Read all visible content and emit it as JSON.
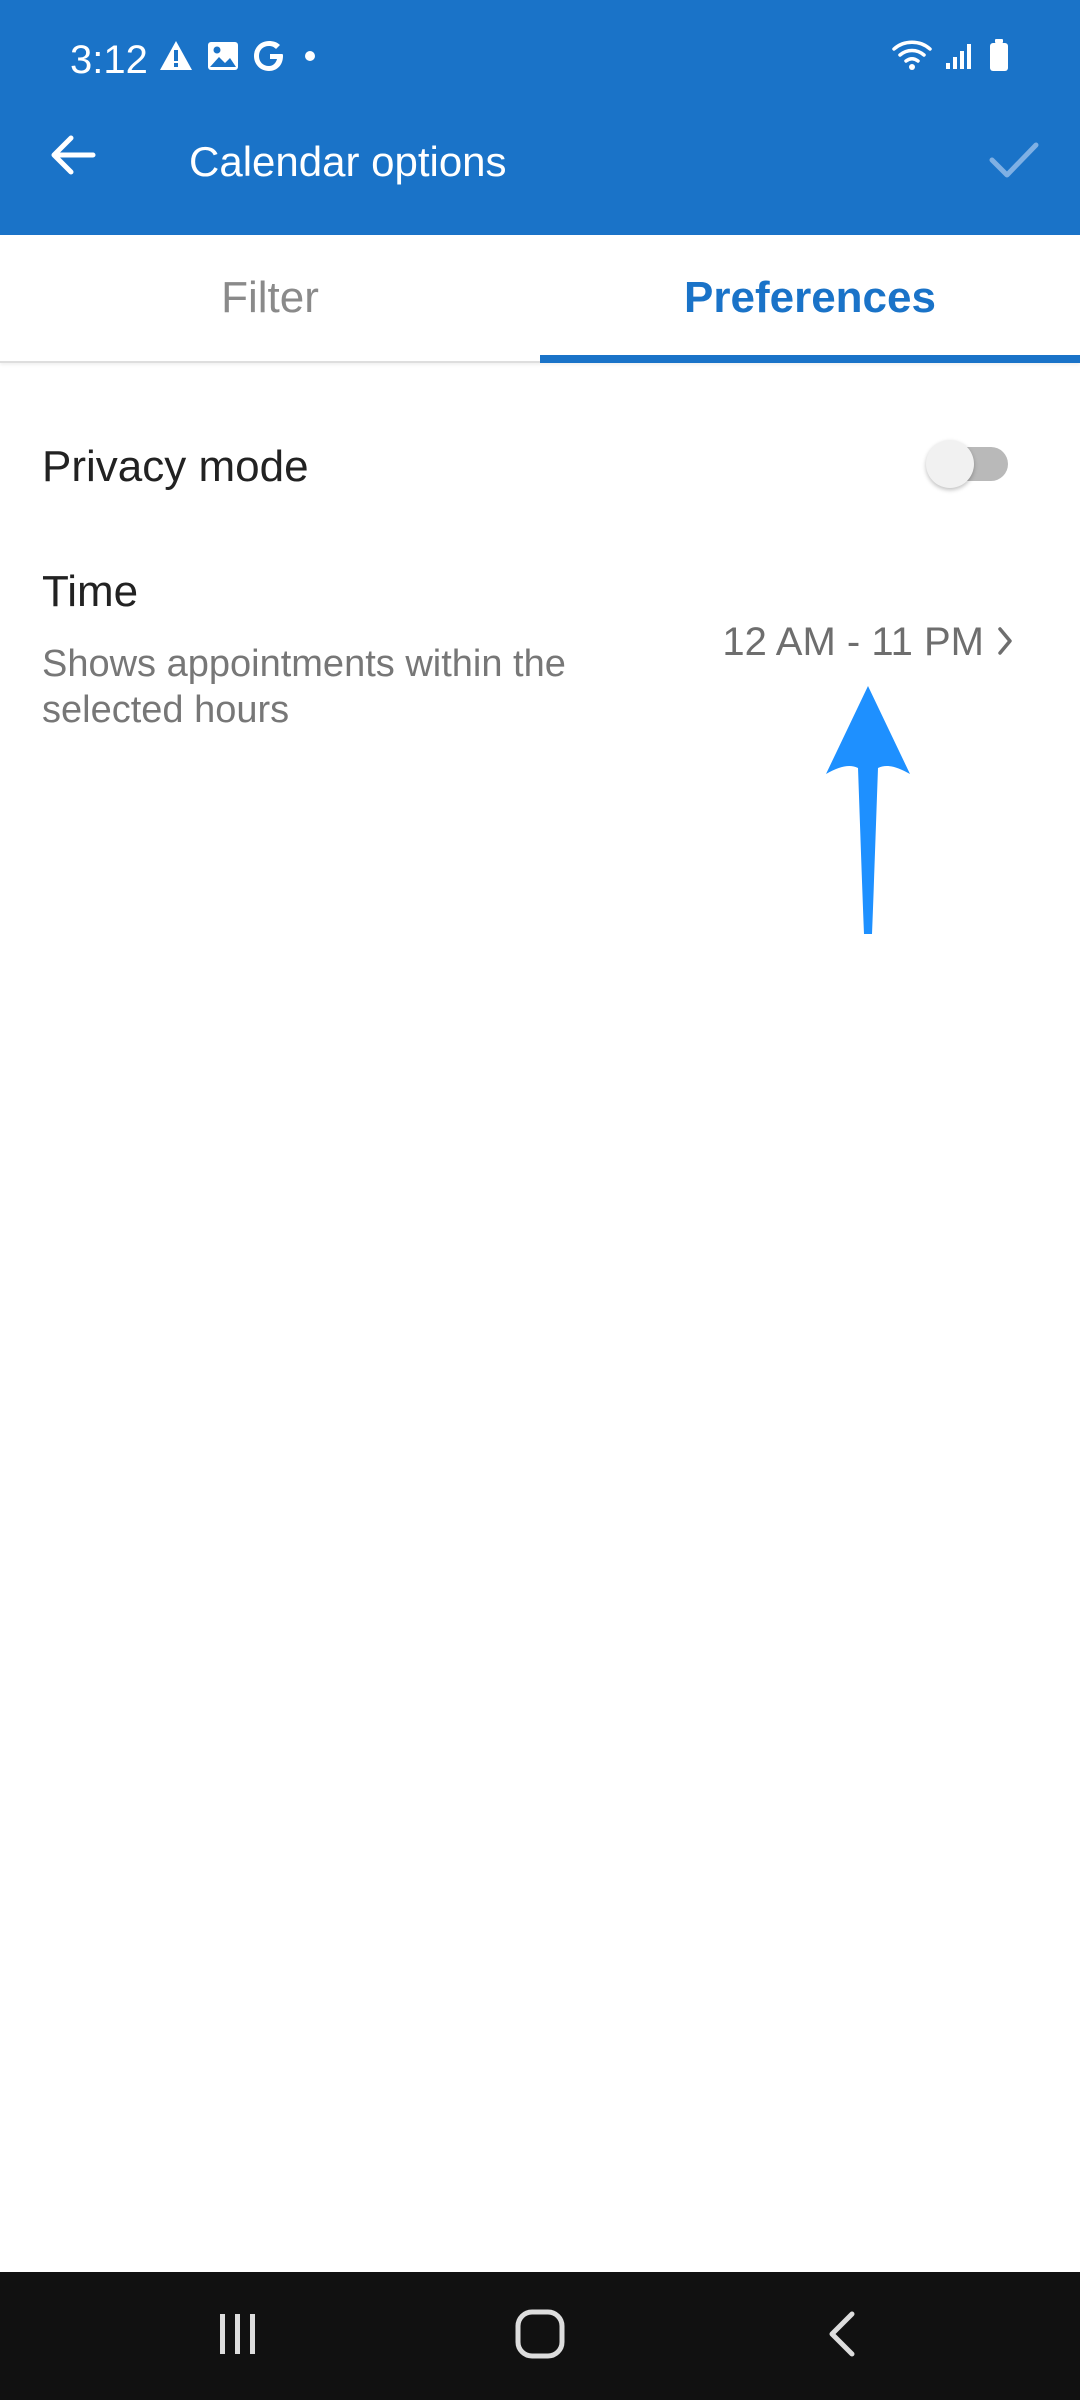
{
  "status_bar": {
    "time": "3:12",
    "left_icons": [
      "warning-icon",
      "image-icon",
      "google-icon",
      "dot-icon"
    ],
    "right_icons": [
      "wifi-icon",
      "signal-icon",
      "battery-icon"
    ]
  },
  "app_bar": {
    "title": "Calendar options",
    "back_icon": "arrow-left-icon",
    "confirm_icon": "checkmark-icon",
    "background_color": "#1a73c8"
  },
  "tabs": [
    {
      "label": "Filter",
      "selected": false
    },
    {
      "label": "Preferences",
      "selected": true
    }
  ],
  "preferences": {
    "privacy_mode": {
      "label": "Privacy mode",
      "enabled": false
    },
    "time": {
      "label": "Time",
      "description": "Shows appointments within the selected hours",
      "value": "12 AM - 11 PM",
      "chevron_icon": "chevron-right-icon"
    }
  },
  "annotation": {
    "icon": "arrow-up-icon",
    "color": "#1e90ff"
  },
  "nav_bar": {
    "buttons": [
      "recents-icon",
      "home-icon",
      "back-icon"
    ]
  }
}
